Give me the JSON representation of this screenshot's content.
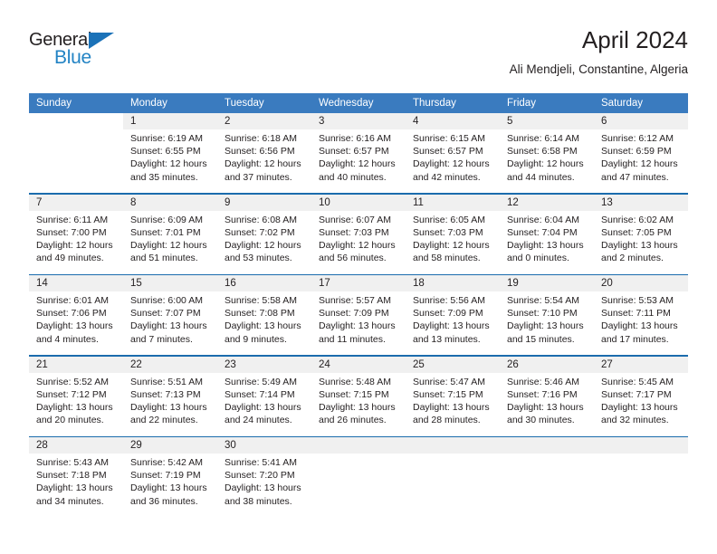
{
  "brand": {
    "name_part1": "General",
    "name_part2": "Blue",
    "triangle_icon": "triangle-icon",
    "color_dark": "#231f20",
    "color_blue": "#2283c4"
  },
  "header": {
    "title": "April 2024",
    "subtitle": "Ali Mendjeli, Constantine, Algeria"
  },
  "theme": {
    "header_bg": "#3a7bbf",
    "separator": "#1b6cad",
    "daynum_bg": "#f0f0f0",
    "text": "#231f20"
  },
  "calendar": {
    "weekday_headers": [
      "Sunday",
      "Monday",
      "Tuesday",
      "Wednesday",
      "Thursday",
      "Friday",
      "Saturday"
    ],
    "weeks": [
      [
        {
          "day": "",
          "sunrise": "",
          "sunset": "",
          "daylight": "",
          "empty": true
        },
        {
          "day": "1",
          "sunrise": "Sunrise: 6:19 AM",
          "sunset": "Sunset: 6:55 PM",
          "daylight": "Daylight: 12 hours and 35 minutes."
        },
        {
          "day": "2",
          "sunrise": "Sunrise: 6:18 AM",
          "sunset": "Sunset: 6:56 PM",
          "daylight": "Daylight: 12 hours and 37 minutes."
        },
        {
          "day": "3",
          "sunrise": "Sunrise: 6:16 AM",
          "sunset": "Sunset: 6:57 PM",
          "daylight": "Daylight: 12 hours and 40 minutes."
        },
        {
          "day": "4",
          "sunrise": "Sunrise: 6:15 AM",
          "sunset": "Sunset: 6:57 PM",
          "daylight": "Daylight: 12 hours and 42 minutes."
        },
        {
          "day": "5",
          "sunrise": "Sunrise: 6:14 AM",
          "sunset": "Sunset: 6:58 PM",
          "daylight": "Daylight: 12 hours and 44 minutes."
        },
        {
          "day": "6",
          "sunrise": "Sunrise: 6:12 AM",
          "sunset": "Sunset: 6:59 PM",
          "daylight": "Daylight: 12 hours and 47 minutes."
        }
      ],
      [
        {
          "day": "7",
          "sunrise": "Sunrise: 6:11 AM",
          "sunset": "Sunset: 7:00 PM",
          "daylight": "Daylight: 12 hours and 49 minutes."
        },
        {
          "day": "8",
          "sunrise": "Sunrise: 6:09 AM",
          "sunset": "Sunset: 7:01 PM",
          "daylight": "Daylight: 12 hours and 51 minutes."
        },
        {
          "day": "9",
          "sunrise": "Sunrise: 6:08 AM",
          "sunset": "Sunset: 7:02 PM",
          "daylight": "Daylight: 12 hours and 53 minutes."
        },
        {
          "day": "10",
          "sunrise": "Sunrise: 6:07 AM",
          "sunset": "Sunset: 7:03 PM",
          "daylight": "Daylight: 12 hours and 56 minutes."
        },
        {
          "day": "11",
          "sunrise": "Sunrise: 6:05 AM",
          "sunset": "Sunset: 7:03 PM",
          "daylight": "Daylight: 12 hours and 58 minutes."
        },
        {
          "day": "12",
          "sunrise": "Sunrise: 6:04 AM",
          "sunset": "Sunset: 7:04 PM",
          "daylight": "Daylight: 13 hours and 0 minutes."
        },
        {
          "day": "13",
          "sunrise": "Sunrise: 6:02 AM",
          "sunset": "Sunset: 7:05 PM",
          "daylight": "Daylight: 13 hours and 2 minutes."
        }
      ],
      [
        {
          "day": "14",
          "sunrise": "Sunrise: 6:01 AM",
          "sunset": "Sunset: 7:06 PM",
          "daylight": "Daylight: 13 hours and 4 minutes."
        },
        {
          "day": "15",
          "sunrise": "Sunrise: 6:00 AM",
          "sunset": "Sunset: 7:07 PM",
          "daylight": "Daylight: 13 hours and 7 minutes."
        },
        {
          "day": "16",
          "sunrise": "Sunrise: 5:58 AM",
          "sunset": "Sunset: 7:08 PM",
          "daylight": "Daylight: 13 hours and 9 minutes."
        },
        {
          "day": "17",
          "sunrise": "Sunrise: 5:57 AM",
          "sunset": "Sunset: 7:09 PM",
          "daylight": "Daylight: 13 hours and 11 minutes."
        },
        {
          "day": "18",
          "sunrise": "Sunrise: 5:56 AM",
          "sunset": "Sunset: 7:09 PM",
          "daylight": "Daylight: 13 hours and 13 minutes."
        },
        {
          "day": "19",
          "sunrise": "Sunrise: 5:54 AM",
          "sunset": "Sunset: 7:10 PM",
          "daylight": "Daylight: 13 hours and 15 minutes."
        },
        {
          "day": "20",
          "sunrise": "Sunrise: 5:53 AM",
          "sunset": "Sunset: 7:11 PM",
          "daylight": "Daylight: 13 hours and 17 minutes."
        }
      ],
      [
        {
          "day": "21",
          "sunrise": "Sunrise: 5:52 AM",
          "sunset": "Sunset: 7:12 PM",
          "daylight": "Daylight: 13 hours and 20 minutes."
        },
        {
          "day": "22",
          "sunrise": "Sunrise: 5:51 AM",
          "sunset": "Sunset: 7:13 PM",
          "daylight": "Daylight: 13 hours and 22 minutes."
        },
        {
          "day": "23",
          "sunrise": "Sunrise: 5:49 AM",
          "sunset": "Sunset: 7:14 PM",
          "daylight": "Daylight: 13 hours and 24 minutes."
        },
        {
          "day": "24",
          "sunrise": "Sunrise: 5:48 AM",
          "sunset": "Sunset: 7:15 PM",
          "daylight": "Daylight: 13 hours and 26 minutes."
        },
        {
          "day": "25",
          "sunrise": "Sunrise: 5:47 AM",
          "sunset": "Sunset: 7:15 PM",
          "daylight": "Daylight: 13 hours and 28 minutes."
        },
        {
          "day": "26",
          "sunrise": "Sunrise: 5:46 AM",
          "sunset": "Sunset: 7:16 PM",
          "daylight": "Daylight: 13 hours and 30 minutes."
        },
        {
          "day": "27",
          "sunrise": "Sunrise: 5:45 AM",
          "sunset": "Sunset: 7:17 PM",
          "daylight": "Daylight: 13 hours and 32 minutes."
        }
      ],
      [
        {
          "day": "28",
          "sunrise": "Sunrise: 5:43 AM",
          "sunset": "Sunset: 7:18 PM",
          "daylight": "Daylight: 13 hours and 34 minutes."
        },
        {
          "day": "29",
          "sunrise": "Sunrise: 5:42 AM",
          "sunset": "Sunset: 7:19 PM",
          "daylight": "Daylight: 13 hours and 36 minutes."
        },
        {
          "day": "30",
          "sunrise": "Sunrise: 5:41 AM",
          "sunset": "Sunset: 7:20 PM",
          "daylight": "Daylight: 13 hours and 38 minutes."
        },
        {
          "day": "",
          "sunrise": "",
          "sunset": "",
          "daylight": "",
          "empty": true
        },
        {
          "day": "",
          "sunrise": "",
          "sunset": "",
          "daylight": "",
          "empty": true
        },
        {
          "day": "",
          "sunrise": "",
          "sunset": "",
          "daylight": "",
          "empty": true
        },
        {
          "day": "",
          "sunrise": "",
          "sunset": "",
          "daylight": "",
          "empty": true
        }
      ]
    ]
  }
}
